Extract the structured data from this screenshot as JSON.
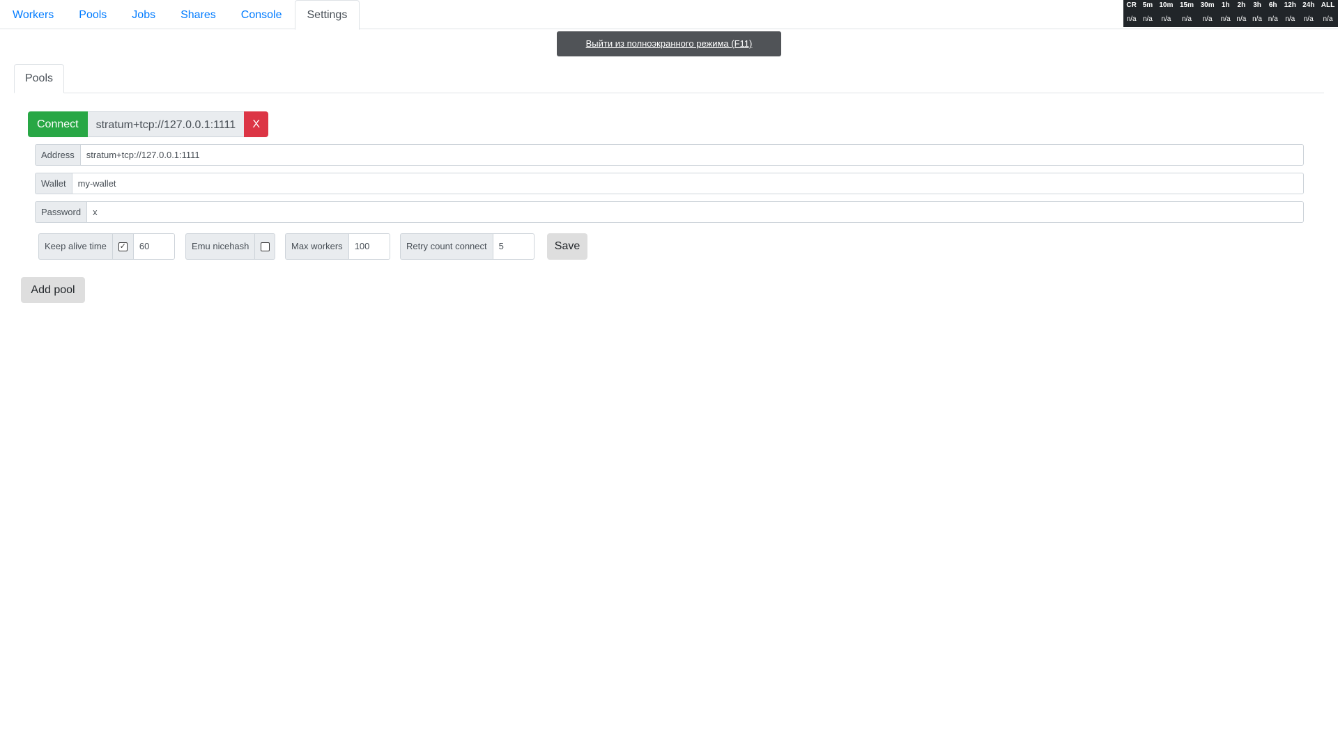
{
  "nav": {
    "tabs": [
      {
        "label": "Workers",
        "active": false
      },
      {
        "label": "Pools",
        "active": false
      },
      {
        "label": "Jobs",
        "active": false
      },
      {
        "label": "Shares",
        "active": false
      },
      {
        "label": "Console",
        "active": false
      },
      {
        "label": "Settings",
        "active": true
      }
    ]
  },
  "stats": {
    "headers": [
      "CR",
      "5m",
      "10m",
      "15m",
      "30m",
      "1h",
      "2h",
      "3h",
      "6h",
      "12h",
      "24h",
      "ALL"
    ],
    "values": [
      "n/a",
      "n/a",
      "n/a",
      "n/a",
      "n/a",
      "n/a",
      "n/a",
      "n/a",
      "n/a",
      "n/a",
      "n/a",
      "n/a"
    ]
  },
  "fullscreen_banner": {
    "label": "Выйти из полноэкранного режима (F11)"
  },
  "settings": {
    "tab_label": "Pools",
    "pool": {
      "connect_label": "Connect",
      "address_display": "stratum+tcp://127.0.0.1:1111",
      "remove_label": "X",
      "fields": {
        "address": {
          "label": "Address",
          "value": "stratum+tcp://127.0.0.1:1111"
        },
        "wallet": {
          "label": "Wallet",
          "value": "my-wallet"
        },
        "password": {
          "label": "Password",
          "value": "x"
        }
      },
      "options": {
        "keep_alive": {
          "label": "Keep alive time",
          "checked": true,
          "check_glyph": "✓",
          "value": "60"
        },
        "emu_nicehash": {
          "label": "Emu nicehash",
          "checked": false
        },
        "max_workers": {
          "label": "Max workers",
          "value": "100"
        },
        "retry_count": {
          "label": "Retry count connect",
          "value": "5"
        }
      },
      "save_label": "Save"
    },
    "add_pool_label": "Add pool"
  },
  "colors": {
    "success": "#28a745",
    "danger": "#dc3545",
    "link": "#007bff",
    "dark": "#212529"
  }
}
